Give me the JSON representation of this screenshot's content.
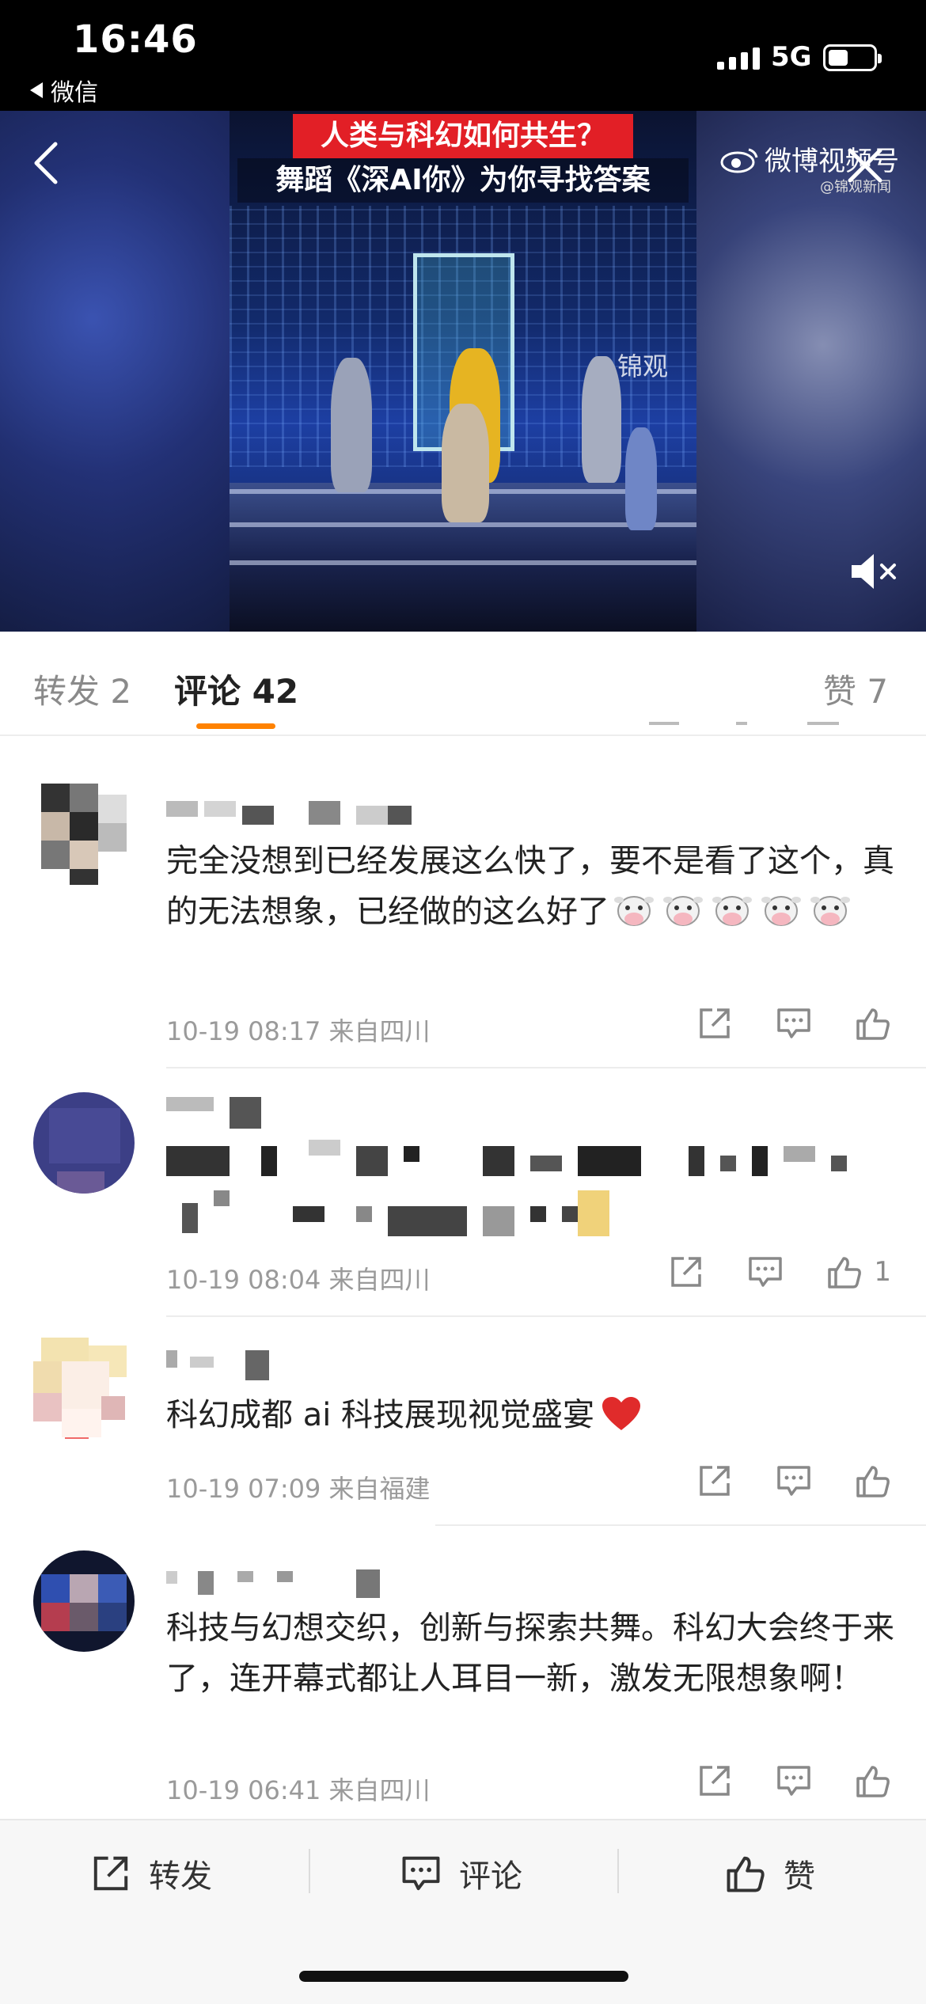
{
  "status_bar": {
    "time": "16:46",
    "back_app": "微信",
    "network": "5G"
  },
  "video": {
    "caption_line1": "人类与科幻如何共生？",
    "caption_line2": "舞蹈《深AI你》为你寻找答案",
    "watermark": "锦观",
    "brand": "微博视频号",
    "brand_sub": "@锦观新闻"
  },
  "tabs": [
    {
      "label": "转发 2"
    },
    {
      "label": "评论 42",
      "active": true
    },
    {
      "label": "赞 7"
    }
  ],
  "comments": [
    {
      "text": "完全没想到已经发展这么快了，要不是看了这个，真的无法想象，已经做的这么好了",
      "emoji": "cow-face",
      "emoji_count": 5,
      "time": "10-19 08:17",
      "location": "来自四川",
      "likes": ""
    },
    {
      "text": "",
      "time": "10-19 08:04",
      "location": "来自四川",
      "likes": "1"
    },
    {
      "text": "科幻成都 ai 科技展现视觉盛宴",
      "emoji": "red-heart",
      "time": "10-19 07:09",
      "location": "来自福建",
      "likes": ""
    },
    {
      "text": "科技与幻想交织，创新与探索共舞。科幻大会终于来了，连开幕式都让人耳目一新，激发无限想象啊！",
      "time": "10-19 06:41",
      "location": "来自四川",
      "likes": ""
    }
  ],
  "bottom_bar": {
    "repost": "转发",
    "comment": "评论",
    "like": "赞"
  },
  "colors": {
    "accent": "#ff8200",
    "caption_red": "#e21f26",
    "meta_gray": "#9a9a9a"
  }
}
